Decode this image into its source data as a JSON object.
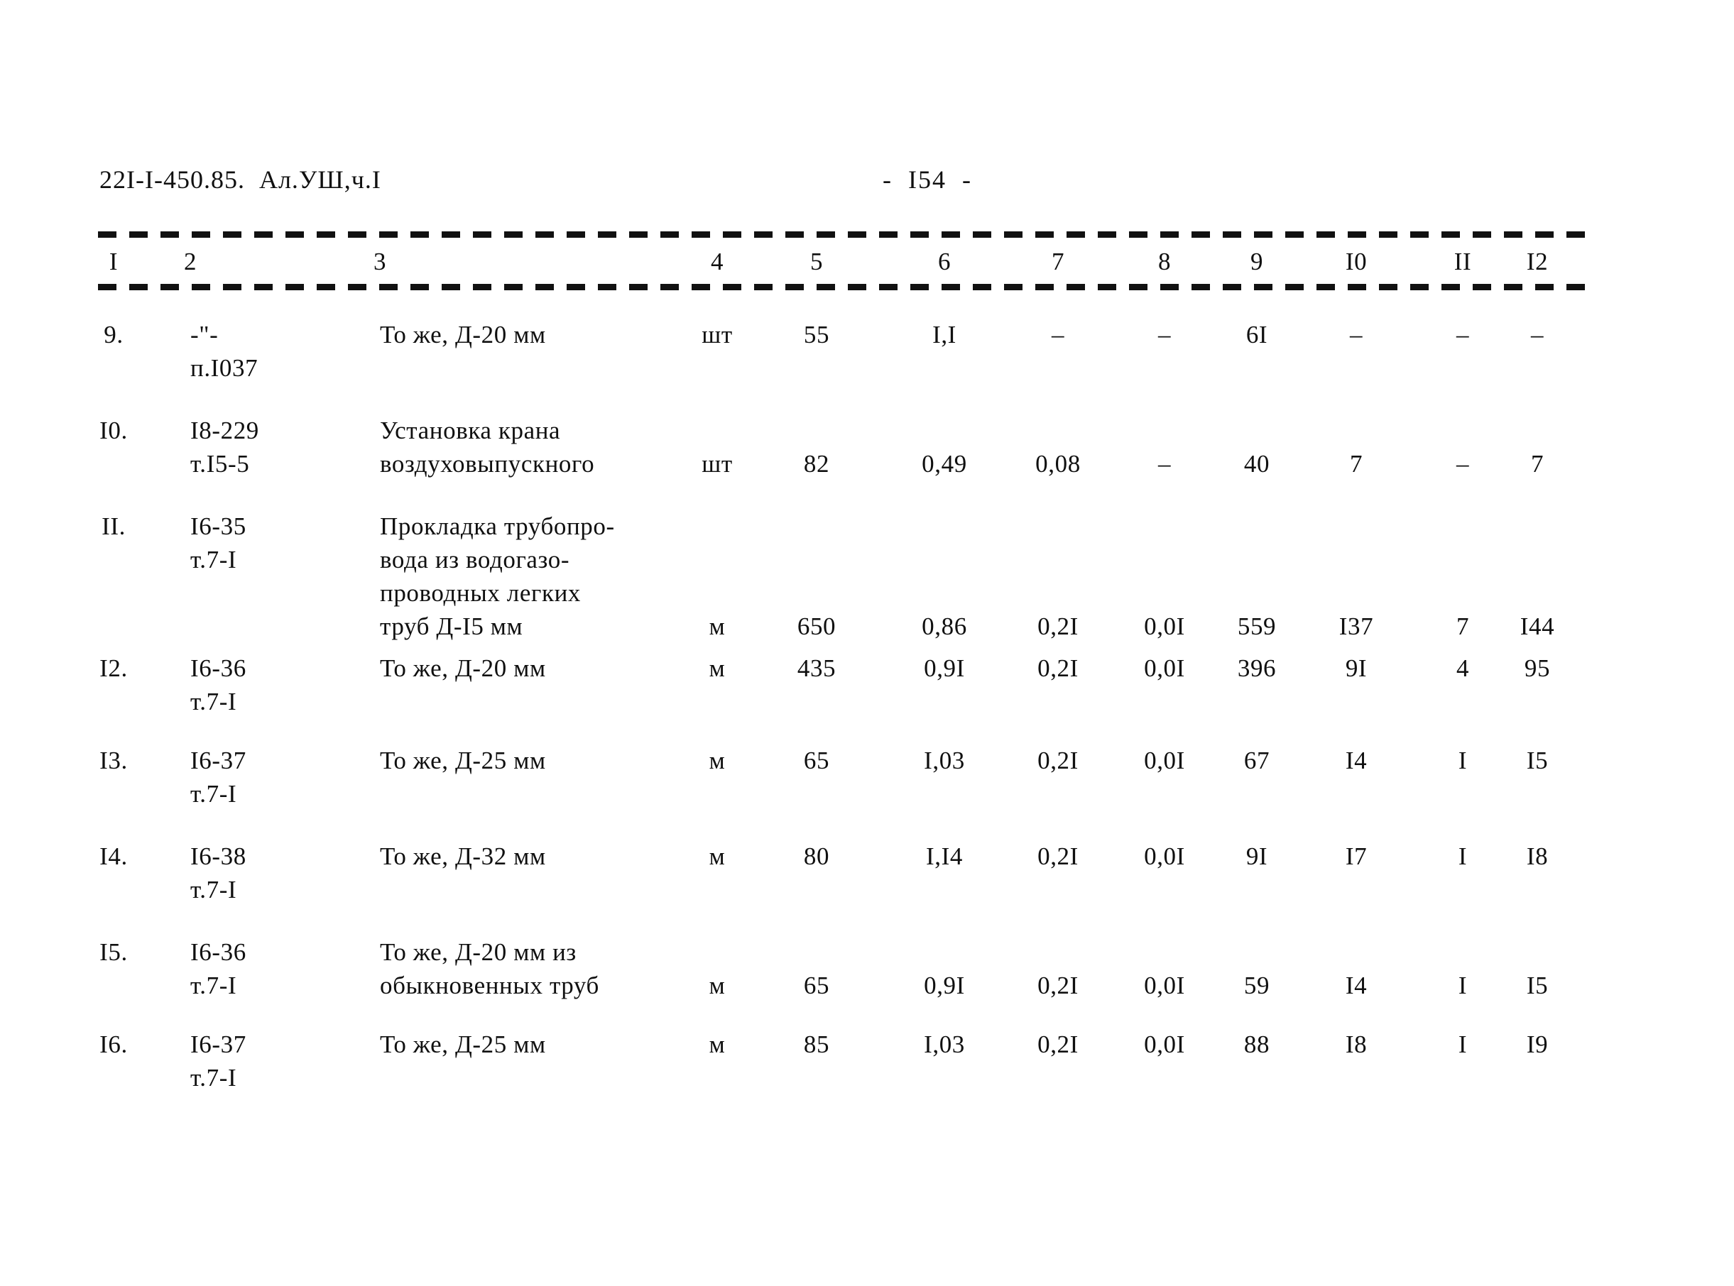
{
  "document": {
    "code": "22I-I-450.85.  Ал.УШ,ч.I",
    "page_label": "-  I54  -"
  },
  "table": {
    "column_headers": [
      "I",
      "2",
      "3",
      "4",
      "5",
      "6",
      "7",
      "8",
      "9",
      "I0",
      "II",
      "I2"
    ],
    "rows": [
      {
        "no": "9.",
        "code_line1": "-\"-",
        "code_line2": "п.I037",
        "name_lines": [
          "То же, Д-20 мм"
        ],
        "unit": "шт",
        "qty": "55",
        "c6": "I,I",
        "c7": "–",
        "c8": "–",
        "c9": "6I",
        "c10": "–",
        "c11": "–",
        "c12": "–"
      },
      {
        "no": "I0.",
        "code_line1": "I8-229",
        "code_line2": "т.I5-5",
        "name_lines": [
          "Установка крана",
          "воздуховыпускного"
        ],
        "unit": "шт",
        "qty": "82",
        "c6": "0,49",
        "c7": "0,08",
        "c8": "–",
        "c9": "40",
        "c10": "7",
        "c11": "–",
        "c12": "7"
      },
      {
        "no": "II.",
        "code_line1": "I6-35",
        "code_line2": "т.7-I",
        "name_lines": [
          "Прокладка трубопро-",
          "вода из водогазо-",
          "проводных легких",
          "труб Д-I5 мм"
        ],
        "unit": "м",
        "qty": "650",
        "c6": "0,86",
        "c7": "0,2I",
        "c8": "0,0I",
        "c9": "559",
        "c10": "I37",
        "c11": "7",
        "c12": "I44"
      },
      {
        "no": "I2.",
        "code_line1": "I6-36",
        "code_line2": "т.7-I",
        "name_lines": [
          "То же, Д-20 мм"
        ],
        "unit": "м",
        "qty": "435",
        "c6": "0,9I",
        "c7": "0,2I",
        "c8": "0,0I",
        "c9": "396",
        "c10": "9I",
        "c11": "4",
        "c12": "95"
      },
      {
        "no": "I3.",
        "code_line1": "I6-37",
        "code_line2": "т.7-I",
        "name_lines": [
          "То же, Д-25 мм"
        ],
        "unit": "м",
        "qty": "65",
        "c6": "I,03",
        "c7": "0,2I",
        "c8": "0,0I",
        "c9": "67",
        "c10": "I4",
        "c11": "I",
        "c12": "I5"
      },
      {
        "no": "I4.",
        "code_line1": "I6-38",
        "code_line2": "т.7-I",
        "name_lines": [
          "То же, Д-32 мм"
        ],
        "unit": "м",
        "qty": "80",
        "c6": "I,I4",
        "c7": "0,2I",
        "c8": "0,0I",
        "c9": "9I",
        "c10": "I7",
        "c11": "I",
        "c12": "I8"
      },
      {
        "no": "I5.",
        "code_line1": "I6-36",
        "code_line2": "т.7-I",
        "name_lines": [
          "То же, Д-20 мм из",
          "обыкновенных труб"
        ],
        "unit": "м",
        "qty": "65",
        "c6": "0,9I",
        "c7": "0,2I",
        "c8": "0,0I",
        "c9": "59",
        "c10": "I4",
        "c11": "I",
        "c12": "I5"
      },
      {
        "no": "I6.",
        "code_line1": "I6-37",
        "code_line2": "т.7-I",
        "name_lines": [
          "То же, Д-25 мм"
        ],
        "unit": "м",
        "qty": "85",
        "c6": "I,03",
        "c7": "0,2I",
        "c8": "0,0I",
        "c9": "88",
        "c10": "I8",
        "c11": "I",
        "c12": "I9"
      }
    ]
  }
}
